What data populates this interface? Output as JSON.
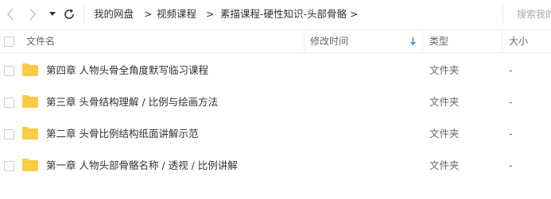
{
  "breadcrumb": {
    "items": [
      "我的网盘",
      "视频课程",
      "素描课程-硬性知识-头部骨骼"
    ],
    "separator": ">"
  },
  "search": {
    "placeholder": "搜索我的"
  },
  "columns": {
    "name": "文件名",
    "modified": "修改时间",
    "type": "类型",
    "size": "大小",
    "sort_column": "modified",
    "sort_direction": "descending"
  },
  "files": [
    {
      "name": "第四章 人物头骨全角度默写临习课程",
      "type": "文件夹",
      "size": "-"
    },
    {
      "name": "第三章 头骨结构理解 / 比例与绘画方法",
      "type": "文件夹",
      "size": "-"
    },
    {
      "name": "第二章 头骨比例结构纸面讲解示范",
      "type": "文件夹",
      "size": "-"
    },
    {
      "name": "第一章 人物头部骨骼名称 / 透视 / 比例讲解",
      "type": "文件夹",
      "size": "-"
    }
  ],
  "icons": {
    "back": "chevron-left-icon",
    "forward": "chevron-right-icon",
    "history": "caret-down-icon",
    "refresh": "refresh-icon",
    "folder": "folder-icon",
    "sort": "sort-down-icon"
  },
  "colors": {
    "folder": "#f9cd46",
    "sort_arrow": "#3a9cee",
    "text": "#333333",
    "muted": "#666666"
  }
}
